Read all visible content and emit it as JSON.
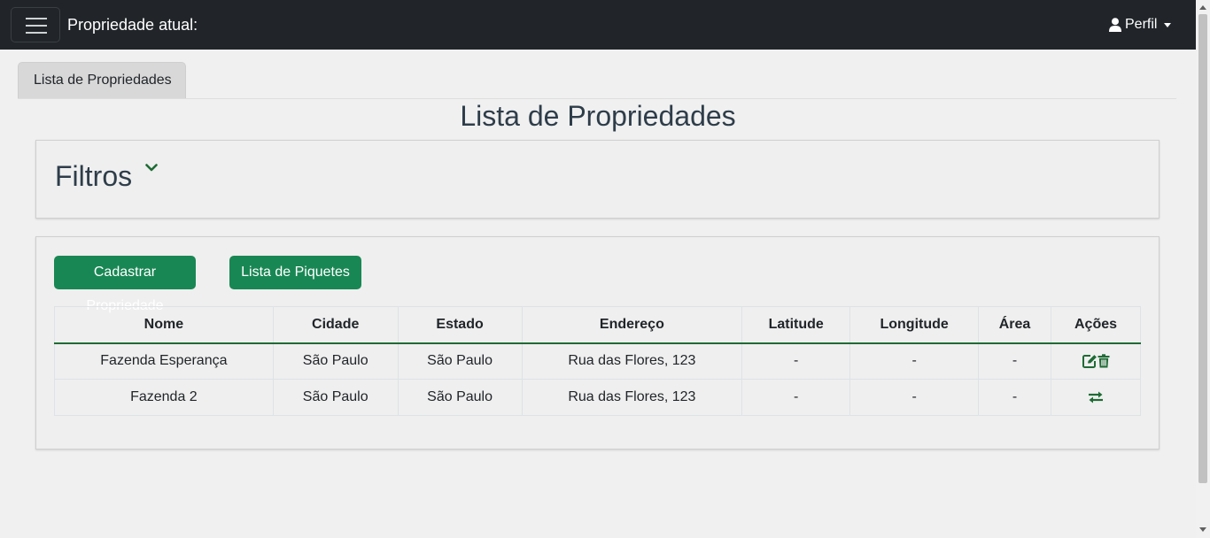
{
  "navbar": {
    "title": "Propriedade atual:",
    "profile_label": "Perfil"
  },
  "tab": {
    "label": "Lista de Propriedades"
  },
  "page": {
    "title": "Lista de Propriedades"
  },
  "filters": {
    "title": "Filtros"
  },
  "buttons": {
    "cadastrar": "Cadastrar Propriedade",
    "piquetes": "Lista de Piquetes"
  },
  "table": {
    "headers": [
      "Nome",
      "Cidade",
      "Estado",
      "Endereço",
      "Latitude",
      "Longitude",
      "Área",
      "Ações"
    ],
    "rows": [
      {
        "nome": "Fazenda Esperança",
        "cidade": "São Paulo",
        "estado": "São Paulo",
        "endereco": "Rua das Flores, 123",
        "latitude": "-",
        "longitude": "-",
        "area": "-",
        "acoes": [
          "edit-icon",
          "trash-icon"
        ]
      },
      {
        "nome": "Fazenda 2",
        "cidade": "São Paulo",
        "estado": "São Paulo",
        "endereco": "Rua das Flores, 123",
        "latitude": "-",
        "longitude": "-",
        "area": "-",
        "acoes": [
          "exchange-icon"
        ]
      }
    ]
  },
  "colors": {
    "navbar_bg": "#212529",
    "accent_green": "#198754",
    "page_bg": "#f0f0f0"
  }
}
